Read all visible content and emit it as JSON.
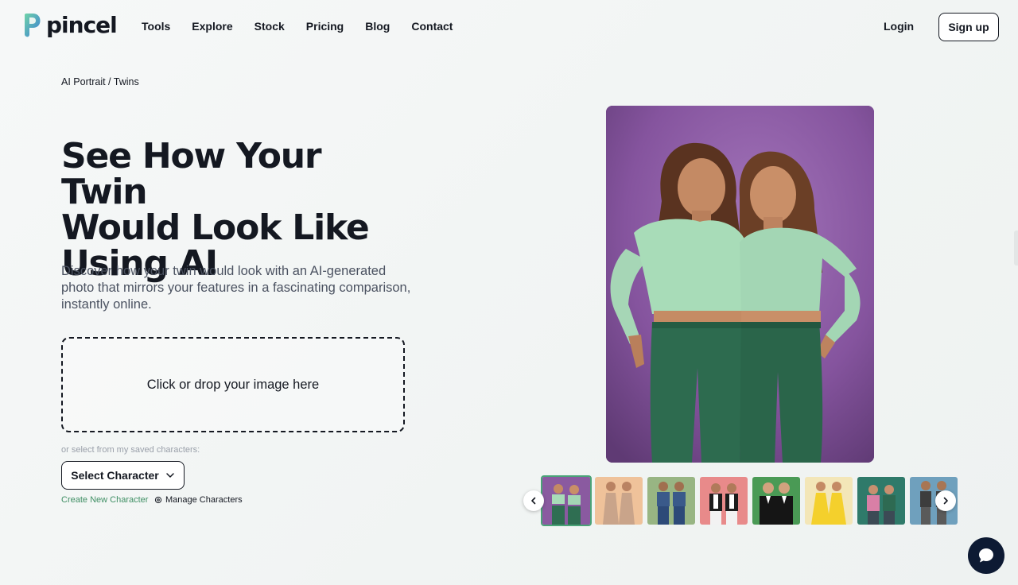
{
  "brand": {
    "name": "pincel",
    "logo_icon": "pincel-logo-icon"
  },
  "nav": {
    "items": [
      "Tools",
      "Explore",
      "Stock",
      "Pricing",
      "Blog",
      "Contact"
    ]
  },
  "auth": {
    "login": "Login",
    "signup": "Sign up"
  },
  "breadcrumb": "AI Portrait / Twins",
  "hero": {
    "title_line1": "See How Your Twin",
    "title_line2": "Would Look Like",
    "title_line3": "Using AI",
    "description": "Discover how your twin would look with an AI-generated photo that mirrors your features in a fascinating comparison, instantly online."
  },
  "upload": {
    "dropzone_text": "Click or drop your image here"
  },
  "characters": {
    "saved_label": "or select from my saved characters:",
    "select_button": "Select Character",
    "create_link": "Create New Character",
    "manage_link": "Manage Characters"
  },
  "gallery": {
    "selected_index": 0,
    "thumbnails": [
      {
        "name": "twins-green-outfits",
        "bg": "#8a5aa0",
        "cloth": "#2f6e52"
      },
      {
        "name": "twins-beige-gowns",
        "bg": "#efc29a",
        "cloth": "#c9a48a"
      },
      {
        "name": "twins-men-denim",
        "bg": "#98b583",
        "cloth": "#2d4a78"
      },
      {
        "name": "twins-black-white",
        "bg": "#e88a8a",
        "cloth": "#1c1c1c"
      },
      {
        "name": "twins-men-suits",
        "bg": "#4a9a55",
        "cloth": "#151515"
      },
      {
        "name": "twins-yellow-dresses",
        "bg": "#f3e6b8",
        "cloth": "#f4d02c"
      },
      {
        "name": "twins-pink-green",
        "bg": "#2f7a6a",
        "cloth": "#d97fa6"
      },
      {
        "name": "twins-men-grey",
        "bg": "#6fa0bd",
        "cloth": "#3d3d3d"
      }
    ],
    "prev_icon": "chevron-left-icon",
    "next_icon": "chevron-right-icon"
  },
  "chat": {
    "icon": "chat-bubble-icon"
  },
  "colors": {
    "primary": "#141821",
    "accent_green": "#3f8f64",
    "chat_bg": "#0d1a33"
  }
}
